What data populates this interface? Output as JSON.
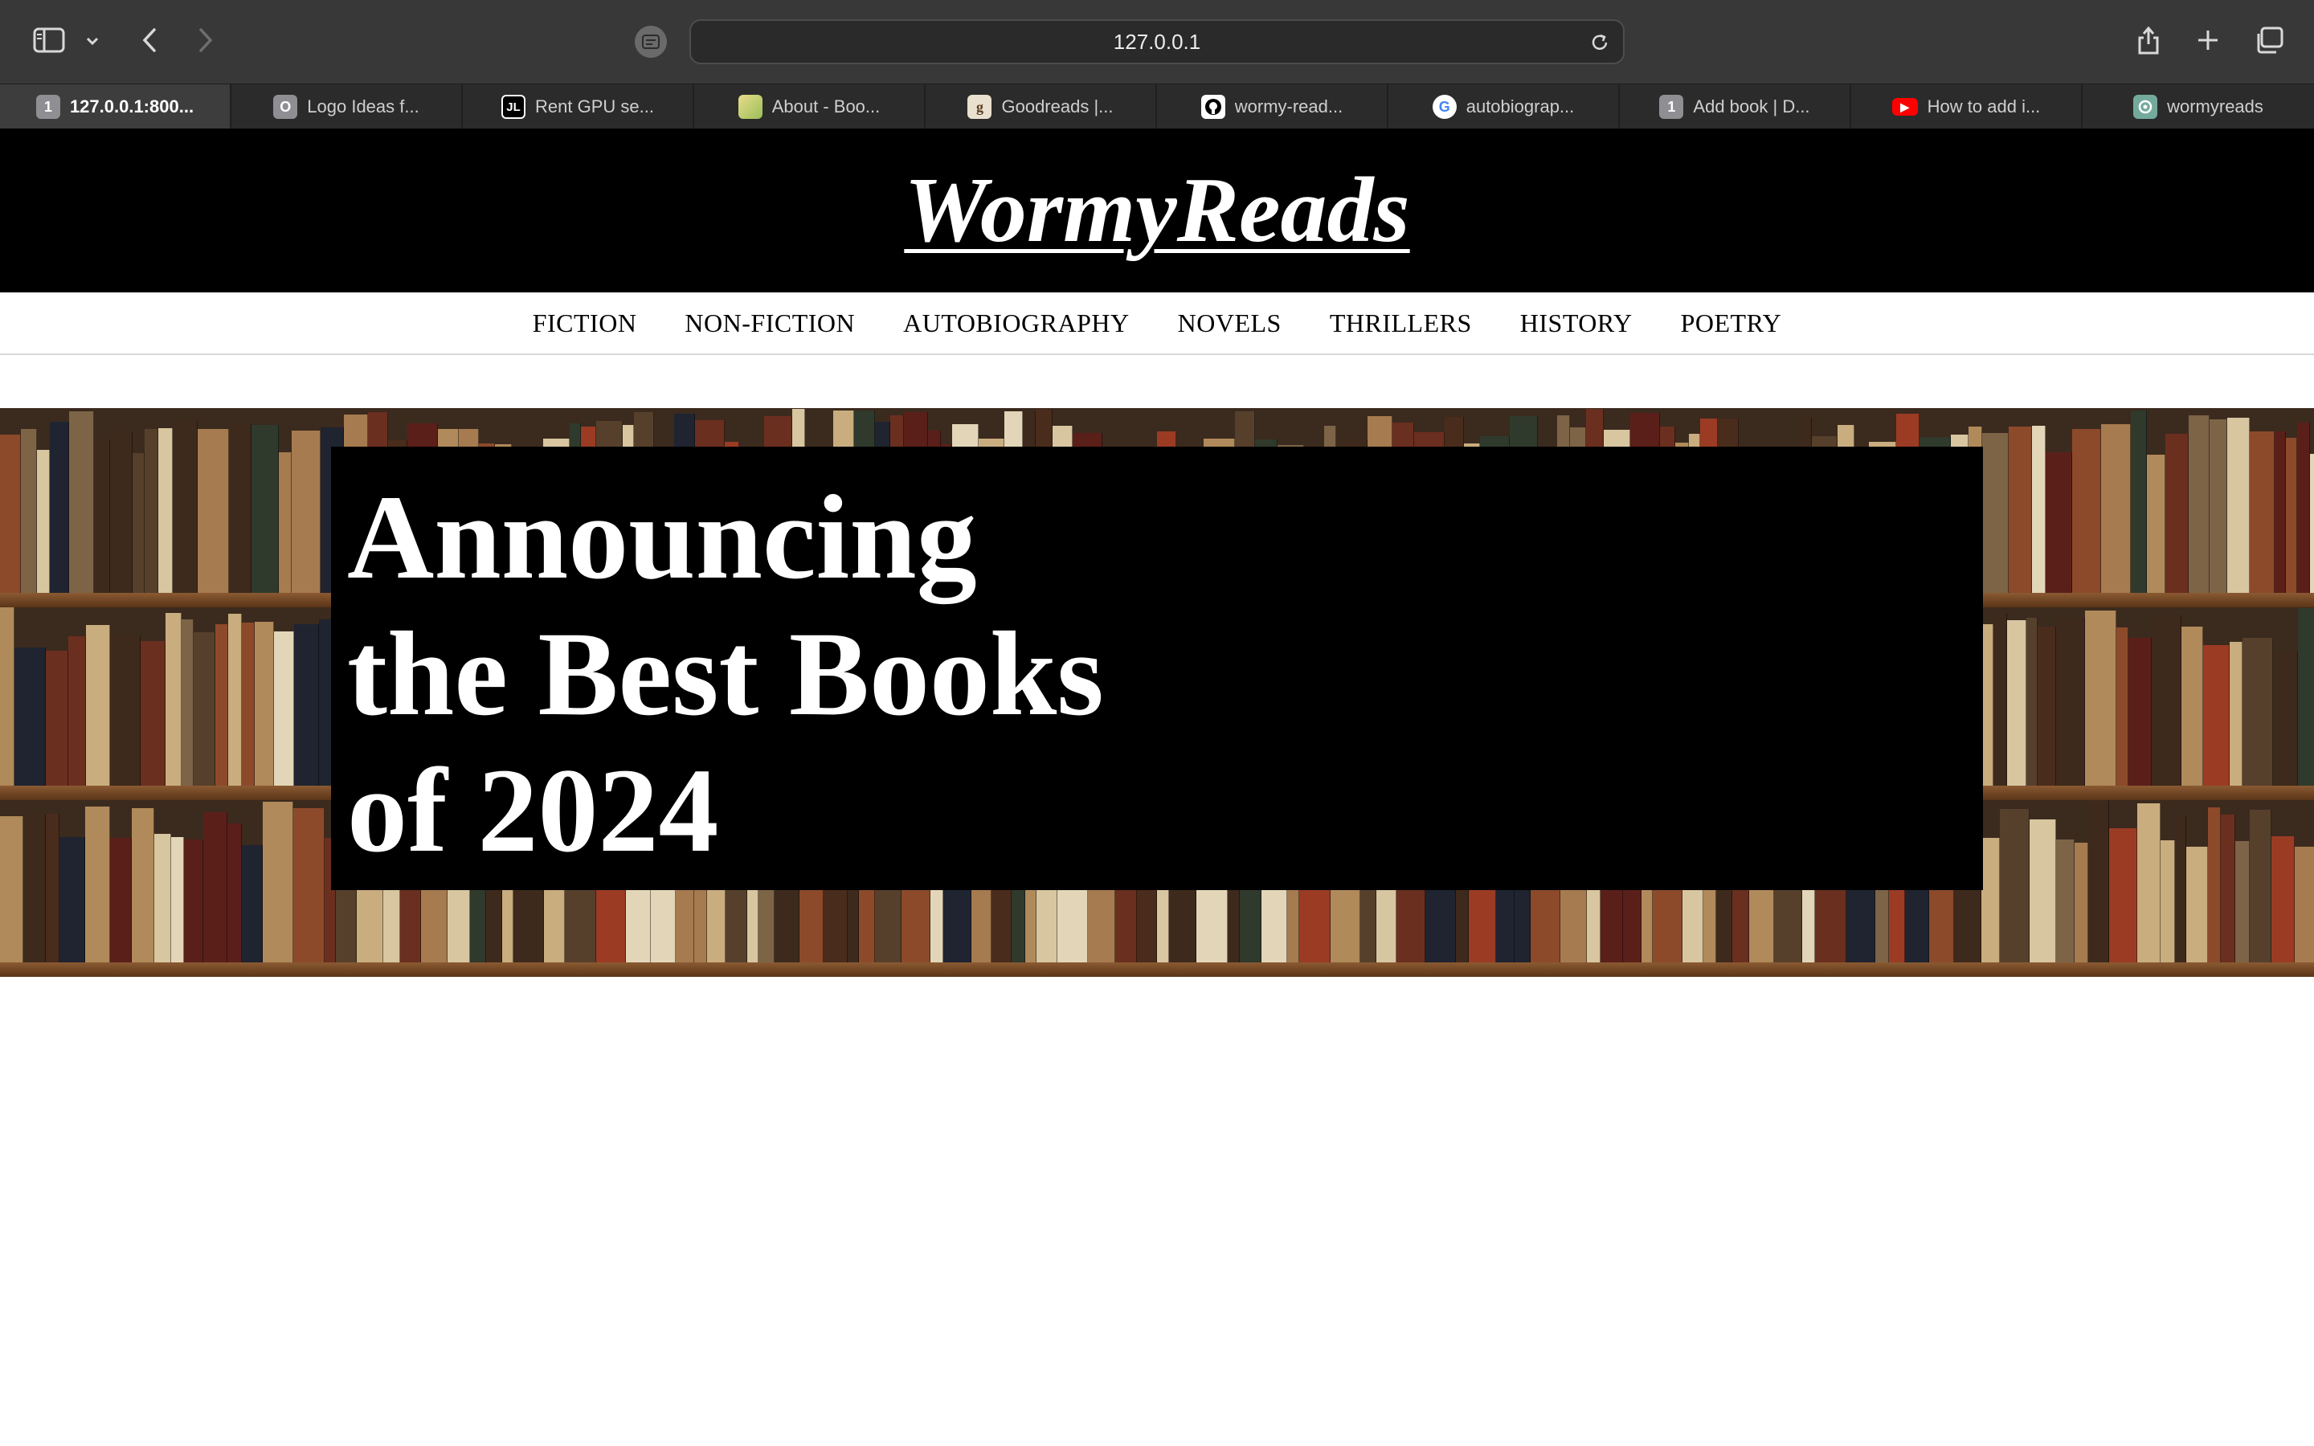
{
  "browser": {
    "url": "127.0.0.1",
    "tabs": [
      {
        "title": "127.0.0.1:800...",
        "icon_text": "1",
        "icon_bg": "#8e8e93",
        "icon_fg": "#ffffff",
        "active": true
      },
      {
        "title": "Logo Ideas f...",
        "icon_text": "O",
        "icon_bg": "#8e8e93",
        "icon_fg": "#ffffff",
        "active": false
      },
      {
        "title": "Rent GPU se...",
        "icon_text": "JL",
        "icon_bg": "#000000",
        "icon_fg": "#ffffff",
        "active": false
      },
      {
        "title": "About - Boo...",
        "icon_text": "",
        "icon_bg": "#d9c87a",
        "icon_fg": "#ffffff",
        "active": false
      },
      {
        "title": "Goodreads |...",
        "icon_text": "g",
        "icon_bg": "#e9e0cf",
        "icon_fg": "#5a3b1e",
        "active": false
      },
      {
        "title": "wormy-read...",
        "icon_text": "",
        "icon_bg": "#ffffff",
        "icon_fg": "#000000",
        "active": false
      },
      {
        "title": "autobiograp...",
        "icon_text": "G",
        "icon_bg": "#ffffff",
        "icon_fg": "#4285f4",
        "active": false
      },
      {
        "title": "Add book | D...",
        "icon_text": "1",
        "icon_bg": "#8e8e93",
        "icon_fg": "#ffffff",
        "active": false
      },
      {
        "title": "How to add i...",
        "icon_text": "▶",
        "icon_bg": "#ff0000",
        "icon_fg": "#ffffff",
        "active": false
      },
      {
        "title": "wormyreads",
        "icon_text": "",
        "icon_bg": "#74aa9c",
        "icon_fg": "#ffffff",
        "active": false
      }
    ]
  },
  "site": {
    "logo": "WormyReads",
    "nav": [
      "FICTION",
      "NON-FICTION",
      "AUTOBIOGRAPHY",
      "NOVELS",
      "THRILLERS",
      "HISTORY",
      "POETRY"
    ],
    "hero": {
      "line1": "Announcing",
      "line2": "the Best Books",
      "line3": "of 2024"
    }
  },
  "colors": {
    "header_bg": "#000000",
    "hero_box_bg": "#000000",
    "text_light": "#ffffff"
  }
}
